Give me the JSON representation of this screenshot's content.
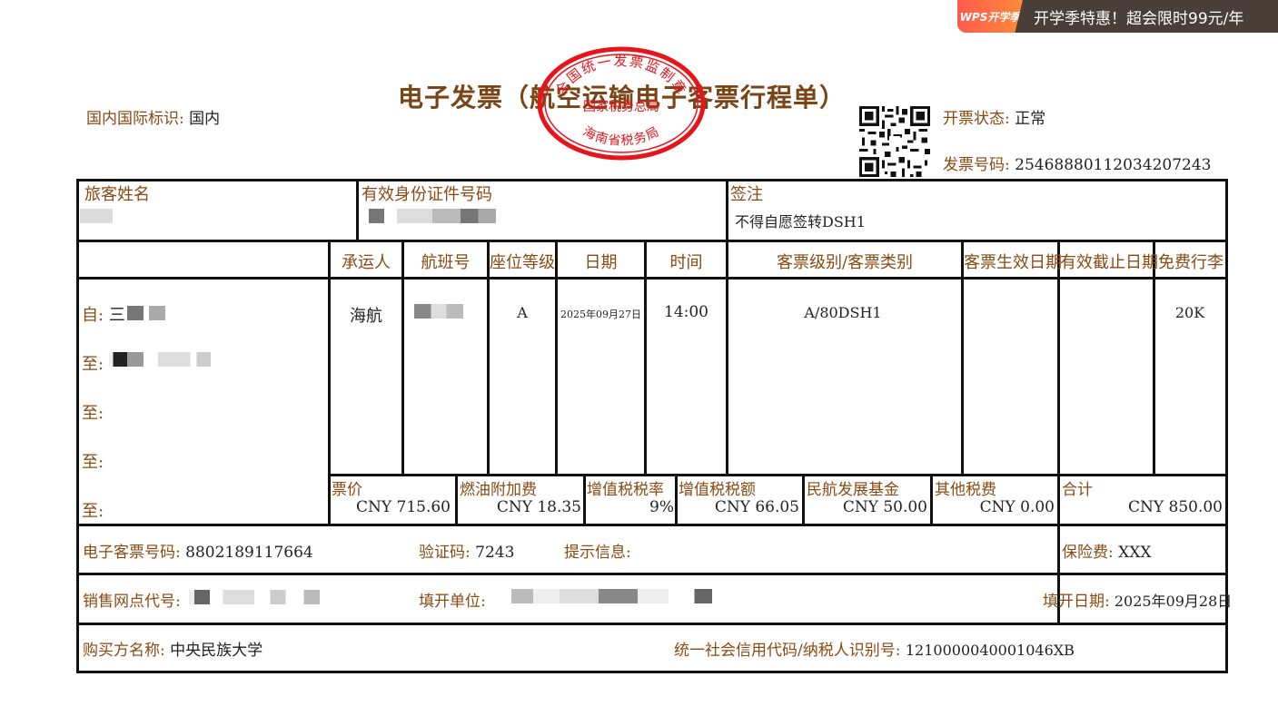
{
  "promo": {
    "logo": "WPS开学季",
    "text": "开学季特惠！超会限时99元/年"
  },
  "title": "电子发票（航空运输电子客票行程单）",
  "stamp": {
    "top": "全国统一发票监制章",
    "middle": "国家税务总局",
    "bottom": "海南省税务局"
  },
  "domestic_label": "国内国际标识:",
  "domestic_value": "国内",
  "status_label": "开票状态:",
  "status_value": "正常",
  "invoice_no_label": "发票号码:",
  "invoice_no_value": "25468880112034207243",
  "passenger_label": "旅客姓名",
  "id_label": "有效身份证件号码",
  "endorse_label": "签注",
  "endorse_value": "不得自愿签转DSH1",
  "headers": {
    "carrier": "承运人",
    "flight": "航班号",
    "seat": "座位等级",
    "date": "日期",
    "time": "时间",
    "fare": "客票级别/客票类别",
    "valid_from": "客票生效日期",
    "valid_to": "有效截止日期",
    "baggage": "免费行李"
  },
  "route": {
    "from": "自:",
    "from_city": "三",
    "to1": "至:",
    "to2": "至:",
    "to3": "至:",
    "to4": "至:"
  },
  "flight_row": {
    "carrier": "海航",
    "seat": "A",
    "date": "2025年09月27日",
    "time": "14:00",
    "fare": "A/80DSH1",
    "baggage": "20K"
  },
  "fees": {
    "fare_label": "票价",
    "fare_value": "CNY 715.60",
    "fuel_label": "燃油附加费",
    "fuel_value": "CNY 18.35",
    "vat_rate_label": "增值税税率",
    "vat_rate_value": "9%",
    "vat_label": "增值税税额",
    "vat_value": "CNY 66.05",
    "caac_label": "民航发展基金",
    "caac_value": "CNY 50.00",
    "other_label": "其他税费",
    "other_value": "CNY 0.00",
    "total_label": "合计",
    "total_value": "CNY 850.00"
  },
  "eticket_label": "电子客票号码:",
  "eticket_value": "8802189117664",
  "verify_label": "验证码:",
  "verify_value": "7243",
  "hint_label": "提示信息:",
  "insurance_label": "保险费:",
  "insurance_value": "XXX",
  "agent_label": "销售网点代号:",
  "issuer_label": "填开单位:",
  "issue_date_label": "填开日期:",
  "issue_date_value": "2025年09月28日",
  "buyer_label": "购买方名称:",
  "buyer_value": "中央民族大学",
  "taxid_label": "统一社会信用代码/纳税人识别号:",
  "taxid_value": "1210000040001046XB"
}
